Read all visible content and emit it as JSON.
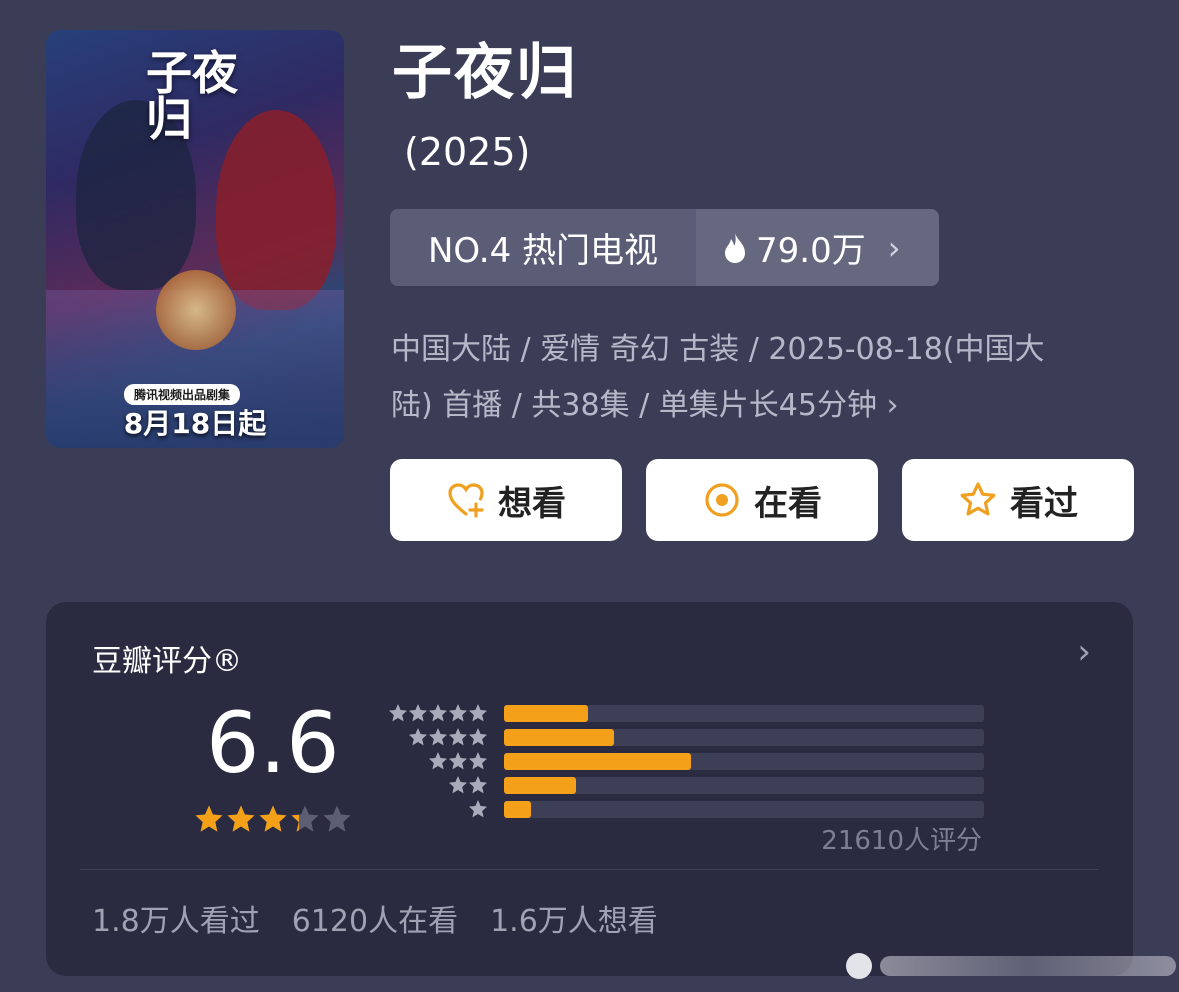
{
  "colors": {
    "background": "#3b3d56",
    "card": "#2a2b41",
    "accent": "#f5a019",
    "muted_text": "#b6b8c9"
  },
  "poster": {
    "calligraphy_title": "子夜归",
    "badge": "腾讯视频出品剧集",
    "release_text": "8月18日起"
  },
  "show": {
    "title": "子夜归",
    "year": "(2025)"
  },
  "rank": {
    "label": "NO.4 热门电视",
    "heat_icon": "flame-icon",
    "heat": "79.0万",
    "chevron_icon": "chevron-right-icon"
  },
  "meta": {
    "line1": "中国大陆 / 爱情 奇幻 古装 / 2025-08-18(中国大",
    "line2": "陆) 首播 / 共38集 / 单集片长45分钟",
    "chevron": "›"
  },
  "actions": [
    {
      "label": "想看",
      "icon": "heart-plus-icon"
    },
    {
      "label": "在看",
      "icon": "target-icon"
    },
    {
      "label": "看过",
      "icon": "star-outline-icon"
    }
  ],
  "rating": {
    "title": "豆瓣评分®",
    "chevron": "›",
    "score": "6.6",
    "stars": 3.3,
    "max_stars": 5,
    "distribution": [
      {
        "stars": 5,
        "fraction": 0.175
      },
      {
        "stars": 4,
        "fraction": 0.23
      },
      {
        "stars": 3,
        "fraction": 0.39
      },
      {
        "stars": 2,
        "fraction": 0.15
      },
      {
        "stars": 1,
        "fraction": 0.056
      }
    ],
    "count": "21610人评分"
  },
  "stats": {
    "watched": "1.8万人看过",
    "watching": "6120人在看",
    "want": "1.6万人想看"
  }
}
